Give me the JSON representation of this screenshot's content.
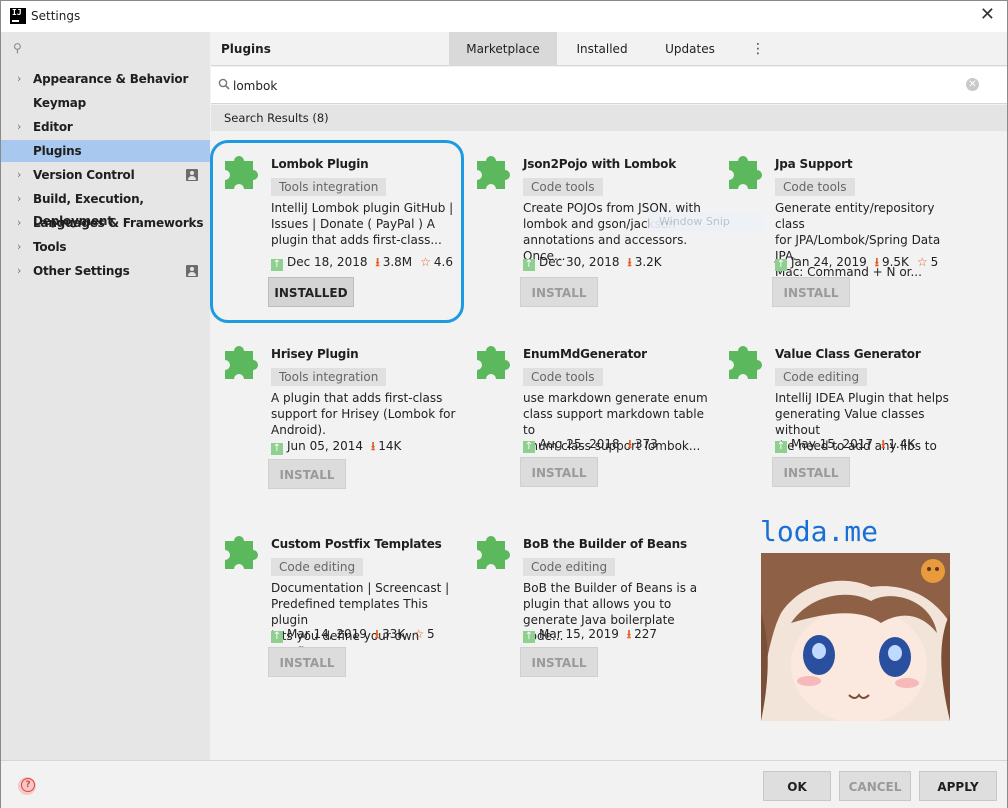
{
  "window": {
    "title": "Settings",
    "close_glyph": "✕"
  },
  "sidebar": {
    "search_glyph": "⚲",
    "items": [
      {
        "label": "Appearance & Behavior",
        "chevron": "›",
        "selected": false,
        "profile": false
      },
      {
        "label": "Keymap",
        "chevron": "",
        "selected": false,
        "profile": false
      },
      {
        "label": "Editor",
        "chevron": "›",
        "selected": false,
        "profile": false
      },
      {
        "label": "Plugins",
        "chevron": "",
        "selected": true,
        "profile": false
      },
      {
        "label": "Version Control",
        "chevron": "›",
        "selected": false,
        "profile": true
      },
      {
        "label": "Build, Execution, Deployment",
        "chevron": "›",
        "selected": false,
        "profile": false
      },
      {
        "label": "Languages & Frameworks",
        "chevron": "›",
        "selected": false,
        "profile": false
      },
      {
        "label": "Tools",
        "chevron": "›",
        "selected": false,
        "profile": false
      },
      {
        "label": "Other Settings",
        "chevron": "›",
        "selected": false,
        "profile": true
      }
    ]
  },
  "header": {
    "title": "Plugins",
    "tabs": [
      {
        "label": "Marketplace",
        "active": true
      },
      {
        "label": "Installed",
        "active": false
      },
      {
        "label": "Updates",
        "active": false
      }
    ],
    "more_glyph": "⋮"
  },
  "search": {
    "value": "lombok",
    "icon": "search-icon",
    "clear_glyph": "✕"
  },
  "results": {
    "header": "Search Results (8)",
    "plugins": [
      {
        "name": "Lombok Plugin",
        "tag": "Tools integration",
        "description": "IntelliJ Lombok plugin GitHub |\nIssues | Donate ( PayPal ) A\nplugin that adds first-class...",
        "date": "Dec 18, 2018",
        "downloads": "3.8M",
        "rating": "4.6",
        "button": "INSTALLED",
        "installed": true
      },
      {
        "name": "Json2Pojo with Lombok",
        "tag": "Code tools",
        "description": "Create POJOs from JSON, with\nlombok and gson/jackson\nannotations and accessors. Once...",
        "date": "Dec 30, 2018",
        "downloads": "3.2K",
        "rating": "",
        "button": "INSTALL",
        "installed": false
      },
      {
        "name": "Jpa Support",
        "tag": "Code tools",
        "description": "Generate entity/repository class\nfor JPA/Lombok/Spring Data JPA.\nMac: Command + N or...",
        "date": "Jan 24, 2019",
        "downloads": "9.5K",
        "rating": "5",
        "button": "INSTALL",
        "installed": false
      },
      {
        "name": "Hrisey Plugin",
        "tag": "Tools integration",
        "description": "A plugin that adds first-class\nsupport for Hrisey (Lombok for\nAndroid).",
        "date": "Jun 05, 2014",
        "downloads": "14K",
        "rating": "",
        "button": "INSTALL",
        "installed": false
      },
      {
        "name": "EnumMdGenerator",
        "tag": "Code tools",
        "description": "use markdown generate enum\nclass support markdown table to\nenum class support lombok...",
        "date": "Aug 25, 2018",
        "downloads": "373",
        "rating": "",
        "button": "INSTALL",
        "installed": false
      },
      {
        "name": "Value Class Generator",
        "tag": "Code editing",
        "description": "IntelliJ IDEA Plugin that helps\ngenerating Value classes without\nthe need to add any libs to your...",
        "date": "May 15, 2017",
        "downloads": "1.4K",
        "rating": "",
        "button": "INSTALL",
        "installed": false
      },
      {
        "name": "Custom Postfix Templates",
        "tag": "Code editing",
        "description": "Documentation | Screencast |\nPredefined templates This plugin\nlets you define your own postfix...",
        "date": "Mar 14, 2019",
        "downloads": "33K",
        "rating": "5",
        "button": "INSTALL",
        "installed": false
      },
      {
        "name": "BoB the Builder of Beans",
        "tag": "Code editing",
        "description": "BoB the Builder of Beans is a\nplugin that allows you to\ngenerate Java boilerplate code...",
        "date": "Mar 15, 2019",
        "downloads": "227",
        "rating": "",
        "button": "INSTALL",
        "installed": false
      }
    ]
  },
  "overlay": {
    "snip_text": "Window Snip",
    "watermark": "loda.me"
  },
  "footer": {
    "ok": "OK",
    "cancel": "CANCEL",
    "apply": "APPLY"
  },
  "colors": {
    "accent": "#a8c8f0",
    "highlight": "#1e9be0",
    "puzzle": "#5cb85c",
    "download": "#e2602a",
    "watermark": "#1a6fd6"
  }
}
